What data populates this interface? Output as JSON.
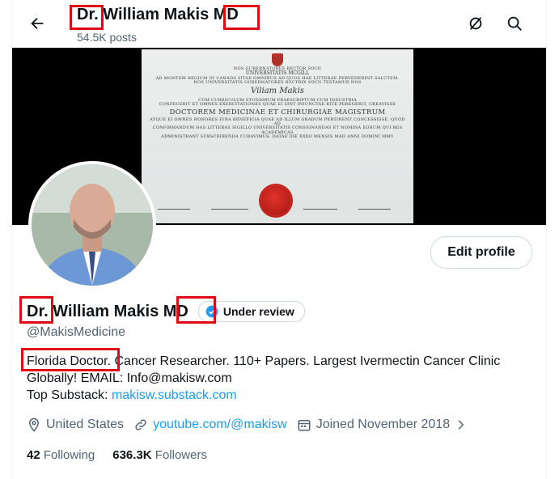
{
  "header": {
    "display_name": "Dr. William Makis MD",
    "posts_count": "54.5K posts",
    "back_icon": "arrow-left-icon",
    "search_icon": "search-icon",
    "no_notify_icon": "notification-off-icon"
  },
  "banner": {
    "diploma_lines": [
      "NOS GUBERNATORES RECTOR SOCII",
      "UNIVERSITATIS MCGILL",
      "AD MONTEM REGIUM IN CANADA SITAE OMNIBUS AD QUOS HAE LITTERAE PERVENERINT SALUTEM.",
      "NOS UNIVERSITATIS GUBERNATORES RECTRIX SOCII TESTAMUR NOS",
      "Viliam Makis",
      "CUM CURRICULUM STUDIORUM PRAESCRIPTUM CUM INDUSTRIA",
      "CONFECERIT ET OMNES EXERCITATIONES QUAE EI SINT INIUNCTAE RITE PEREGERIT, CREAVISSE",
      "DOCTOREM MEDICINAE ET CHIRURGIAE MAGISTRUM",
      "ATQUE EI OMNES HONORES IURA BENEFICIA QUAE AD ILLUM GRADUM PERTINENT CONCESSISSE. QUOD AD",
      "CONFIRMANDUM HAS LITTERAS SIGILLO UNIVERSITATIS CONSIGNANDAS ET NOMINA EORUM QUI RES ACADEMICAS",
      "ADMINISTRANT SUBSCRIBENDA CURAVIMUS. DATAE DIE XXXO MENSIS MAII ANNI DOMINI MMV"
    ]
  },
  "profile": {
    "edit_label": "Edit profile",
    "name": "Dr. William Makis MD",
    "verification_icon": "checkmark-badge-icon",
    "verification_label": "Under review",
    "handle": "@MakisMedicine",
    "bio_line1": "Florida Doctor. Cancer Researcher.  110+ Papers. Largest Ivermectin Cancer Clinic",
    "bio_line2": "Globally! EMAIL: Info@makisw.com",
    "bio_substack_prefix": "Top Substack: ",
    "bio_substack_link": "makisw.substack.com",
    "location": "United States",
    "website": "youtube.com/@makisw",
    "joined": "Joined November 2018",
    "following_count": "42",
    "following_label": "Following",
    "followers_count": "636.3K",
    "followers_label": "Followers"
  },
  "annotation_color": "#e00a16",
  "accent_color": "#1d9bf0"
}
